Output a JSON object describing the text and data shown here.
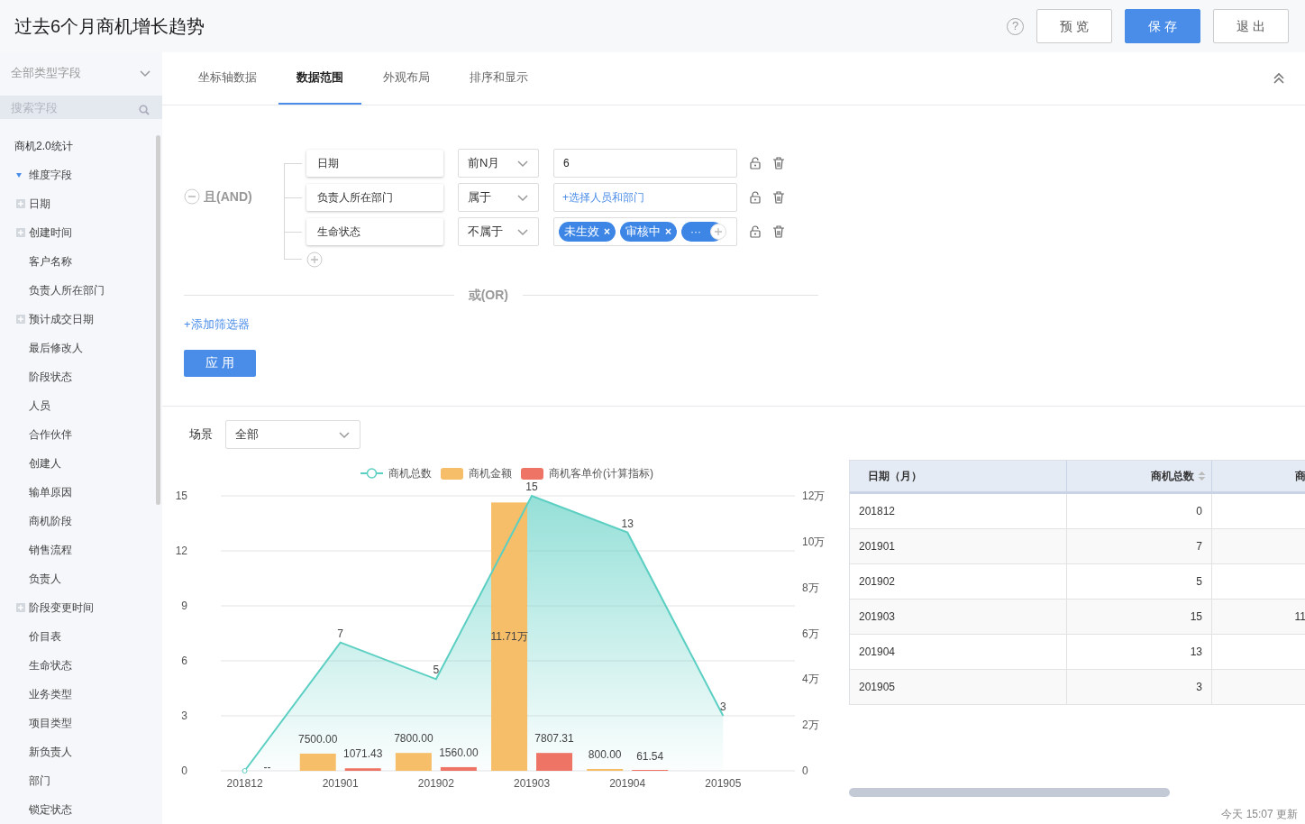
{
  "header": {
    "title": "过去6个月商机增长趋势",
    "help_icon": "?",
    "buttons": [
      {
        "label": "预 览",
        "kind": "default"
      },
      {
        "label": "保 存",
        "kind": "primary"
      },
      {
        "label": "退 出",
        "kind": "default"
      }
    ]
  },
  "sidebar": {
    "type_select": "全部类型字段",
    "search": {
      "placeholder": "搜索字段"
    },
    "tree": [
      {
        "label": "商机2.0统计",
        "kind": "root",
        "children": [
          {
            "label": "维度字段",
            "kind": "folder",
            "expanded": true,
            "children": [
              {
                "label": "日期",
                "kind": "group",
                "expanded": false
              },
              {
                "label": "创建时间",
                "kind": "group",
                "expanded": false
              },
              {
                "label": "客户名称",
                "kind": "field"
              },
              {
                "label": "负责人所在部门",
                "kind": "field"
              },
              {
                "label": "预计成交日期",
                "kind": "group",
                "expanded": false
              },
              {
                "label": "最后修改人",
                "kind": "field"
              },
              {
                "label": "阶段状态",
                "kind": "field"
              },
              {
                "label": "人员",
                "kind": "field"
              },
              {
                "label": "合作伙伴",
                "kind": "field"
              },
              {
                "label": "创建人",
                "kind": "field"
              },
              {
                "label": "输单原因",
                "kind": "field"
              },
              {
                "label": "商机阶段",
                "kind": "field"
              },
              {
                "label": "销售流程",
                "kind": "field"
              },
              {
                "label": "负责人",
                "kind": "field"
              },
              {
                "label": "阶段变更时间",
                "kind": "group",
                "expanded": false
              },
              {
                "label": "价目表",
                "kind": "field"
              },
              {
                "label": "生命状态",
                "kind": "field"
              },
              {
                "label": "业务类型",
                "kind": "field"
              },
              {
                "label": "项目类型",
                "kind": "field"
              },
              {
                "label": "新负责人",
                "kind": "field"
              },
              {
                "label": "部门",
                "kind": "field"
              },
              {
                "label": "锁定状态",
                "kind": "field"
              }
            ]
          }
        ]
      }
    ]
  },
  "tabs": [
    {
      "label": "坐标轴数据",
      "selected": false
    },
    {
      "label": "数据范围",
      "selected": true
    },
    {
      "label": "外观布局",
      "selected": false
    },
    {
      "label": "排序和显示",
      "selected": false
    }
  ],
  "filter": {
    "and_label": "且(AND)",
    "conditions": [
      {
        "field": "日期",
        "operator": "前N月",
        "value": {
          "kind": "text",
          "text": "6"
        }
      },
      {
        "field": "负责人所在部门",
        "operator": "属于",
        "value": {
          "kind": "picker",
          "text": "+选择人员和部门"
        }
      },
      {
        "field": "生命状态",
        "operator": "不属于",
        "value": {
          "kind": "tags",
          "tags": [
            {
              "label": "未生效",
              "remove": "×"
            },
            {
              "label": "审核中",
              "remove": "×"
            }
          ],
          "more": "···"
        }
      }
    ],
    "or_label": "或(OR)",
    "add_filter": "+添加筛选器",
    "apply_button": "应 用"
  },
  "scene": {
    "label": "场景",
    "value": "全部"
  },
  "chart": {
    "chart_data": {
      "type": "bar",
      "categories": [
        "201812",
        "201901",
        "201902",
        "201903",
        "201904",
        "201905"
      ],
      "series": [
        {
          "name": "商机总数",
          "color": "#5ccfc3",
          "type": "line",
          "values": [
            0,
            7,
            5,
            15,
            13,
            3
          ]
        },
        {
          "name": "商机金额",
          "color": "#f6be68",
          "type": "bar",
          "axis": "y2",
          "values": [
            null,
            0.75,
            0.78,
            11.71,
            0.08,
            null
          ]
        },
        {
          "name": "商机客单价(计算指标)",
          "color": "#ee7565",
          "type": "bar",
          "axis": "y2",
          "values": [
            null,
            0.11,
            0.16,
            0.78,
            0.01,
            null
          ]
        }
      ],
      "grid": true,
      "legend": true,
      "ylim": [
        0,
        15
      ],
      "yticks": [
        0,
        3,
        6,
        9,
        12,
        15
      ],
      "y2lim": [
        0,
        12
      ],
      "y2ticks": [
        {
          "value": 0,
          "label": "0"
        },
        {
          "value": 2,
          "label": "2万"
        },
        {
          "value": 4,
          "label": "4万"
        },
        {
          "value": 6,
          "label": "6万"
        },
        {
          "value": 8,
          "label": "8万"
        },
        {
          "value": 10,
          "label": "10万"
        },
        {
          "value": 12,
          "label": "12万"
        }
      ],
      "value_labels": [
        [
          null,
          "7",
          "5",
          "15",
          "13",
          "3"
        ],
        [
          null,
          "7500.00",
          "7800.00",
          "11.71万",
          "800.00",
          null
        ],
        [
          "--",
          "1071.43",
          "1560.00",
          "7807.31",
          "61.54",
          null
        ]
      ]
    }
  },
  "table": {
    "columns": [
      "日期（月）",
      "商机总数",
      "商"
    ],
    "rows": [
      [
        "201812",
        "0",
        ""
      ],
      [
        "201901",
        "7",
        ""
      ],
      [
        "201902",
        "5",
        ""
      ],
      [
        "201903",
        "15",
        "11"
      ],
      [
        "201904",
        "13",
        ""
      ],
      [
        "201905",
        "3",
        ""
      ]
    ]
  },
  "updated": "今天 15:07 更新"
}
